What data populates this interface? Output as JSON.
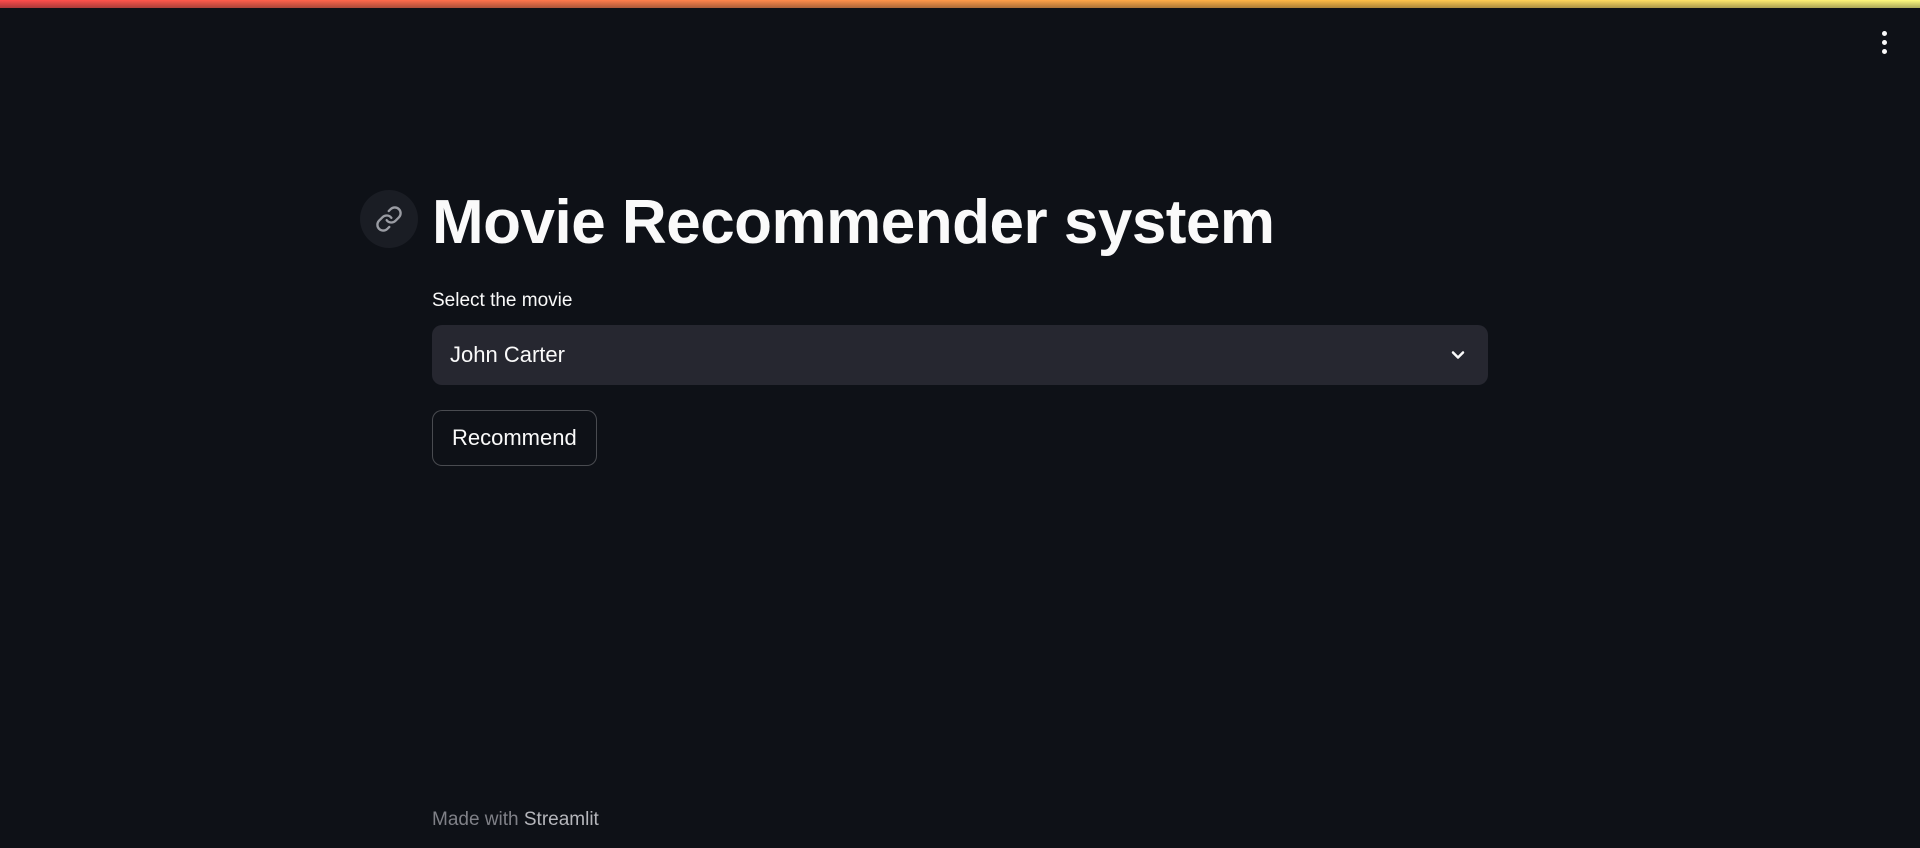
{
  "header": {
    "menu_icon": "vertical-ellipsis-icon",
    "decoration_colors": [
      "#ff4b4b",
      "#ffbd45",
      "#fffd80"
    ]
  },
  "main": {
    "title": "Movie Recommender system",
    "title_anchor_icon": "link-icon",
    "select": {
      "label": "Select the movie",
      "value": "John Carter",
      "icon": "chevron-down-icon"
    },
    "recommend_button": {
      "label": "Recommend"
    }
  },
  "footer": {
    "prefix": "Made with ",
    "brand": "Streamlit"
  },
  "theme": {
    "background": "#0e1117",
    "surface": "#262730",
    "text": "#fafafa"
  }
}
